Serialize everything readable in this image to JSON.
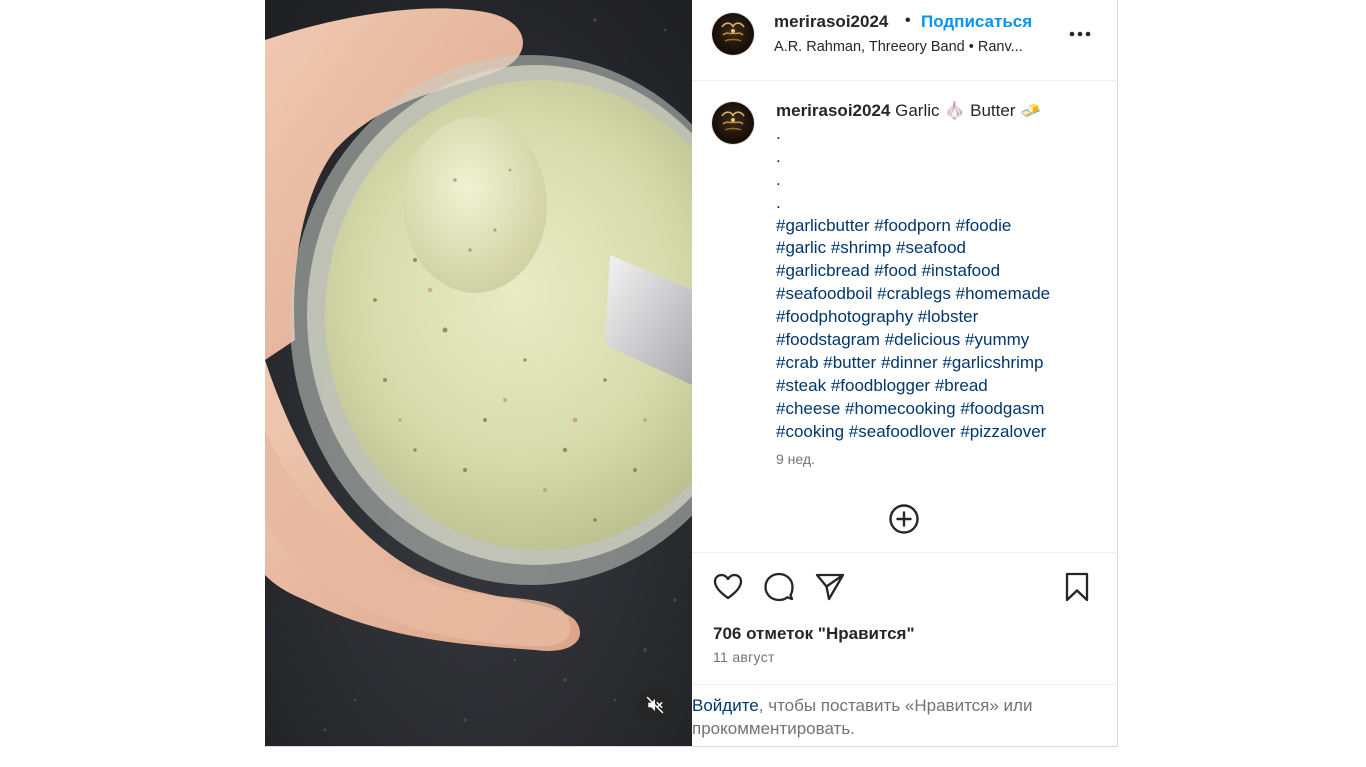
{
  "post": {
    "header": {
      "username": "merirasoi2024",
      "separator": "•",
      "follow_label": "Подписаться",
      "audio_info": "A.R. Rahman, Threeory Band • Ranv..."
    },
    "caption": {
      "username": "merirasoi2024",
      "text": "Garlic 🧄 Butter 🧈",
      "dots": [
        ".",
        ".",
        ".",
        "."
      ],
      "hashtag_lines": [
        [
          "#garlicbutter",
          "#foodporn",
          "#foodie"
        ],
        [
          "#garlic",
          "#shrimp",
          "#seafood"
        ],
        [
          "#garlicbread",
          "#food",
          "#instafood"
        ],
        [
          "#seafoodboil",
          "#crablegs",
          "#homemade"
        ],
        [
          "#foodphotography",
          "#lobster"
        ],
        [
          "#foodstagram",
          "#delicious",
          "#yummy"
        ],
        [
          "#crab",
          "#butter",
          "#dinner",
          "#garlicshrimp"
        ],
        [
          "#steak",
          "#foodblogger",
          "#bread"
        ],
        [
          "#cheese",
          "#homecooking",
          "#foodgasm"
        ],
        [
          "#cooking",
          "#seafoodlover",
          "#pizzalover"
        ]
      ],
      "time_ago": "9 нед."
    },
    "stats": {
      "likes_text": "706 отметок \"Нравится\"",
      "date": "11 август"
    },
    "login_prompt": {
      "link": "Войдите",
      "rest": ", чтобы поставить «Нравится» или прокомментировать."
    },
    "icons": {
      "more": "more-options-icon",
      "add_comment": "plus-circle-icon",
      "like": "heart-icon",
      "comment": "comment-bubble-icon",
      "share": "send-paper-plane-icon",
      "save": "bookmark-icon",
      "mute": "speaker-muted-icon"
    },
    "colors": {
      "accent": "#0095f6",
      "hashtag": "#00376b",
      "secondary_text": "#737373",
      "primary_text": "#262626"
    }
  }
}
